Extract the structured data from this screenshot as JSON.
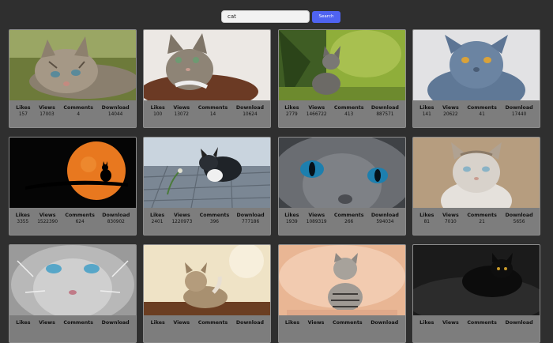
{
  "search": {
    "value": "cat",
    "button_label": "Search"
  },
  "labels": {
    "likes": "Likes",
    "views": "Views",
    "comments": "Comments",
    "download": "Download"
  },
  "cards": [
    {
      "likes": "157",
      "views": "17003",
      "comments": "4",
      "download": "14044"
    },
    {
      "likes": "100",
      "views": "13072",
      "comments": "14",
      "download": "10624"
    },
    {
      "likes": "2779",
      "views": "1466722",
      "comments": "413",
      "download": "887571"
    },
    {
      "likes": "141",
      "views": "20622",
      "comments": "41",
      "download": "17440"
    },
    {
      "likes": "3355",
      "views": "1522390",
      "comments": "624",
      "download": "830902"
    },
    {
      "likes": "2401",
      "views": "1220973",
      "comments": "396",
      "download": "777186"
    },
    {
      "likes": "1939",
      "views": "1089319",
      "comments": "266",
      "download": "594034"
    },
    {
      "likes": "81",
      "views": "7010",
      "comments": "21",
      "download": "5656"
    },
    {
      "likes": "",
      "views": "",
      "comments": "",
      "download": ""
    },
    {
      "likes": "",
      "views": "",
      "comments": "",
      "download": ""
    },
    {
      "likes": "",
      "views": "",
      "comments": "",
      "download": ""
    },
    {
      "likes": "",
      "views": "",
      "comments": "",
      "download": ""
    }
  ]
}
